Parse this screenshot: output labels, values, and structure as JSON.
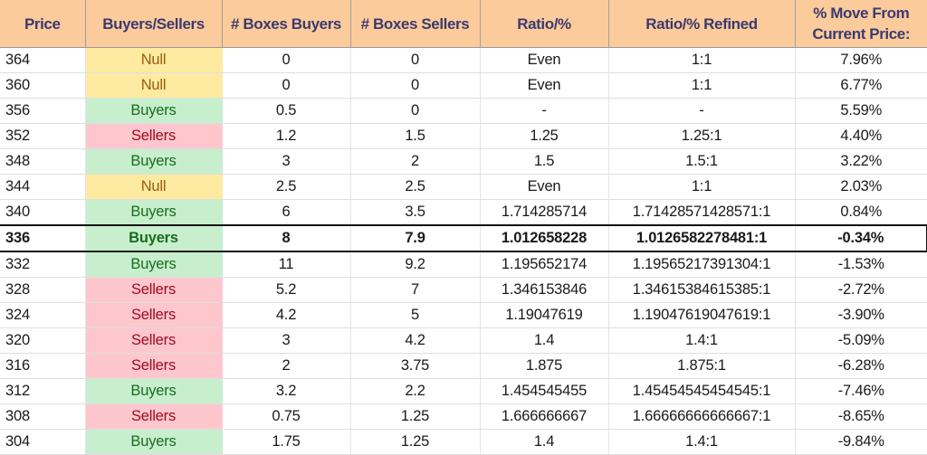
{
  "table": {
    "headers": [
      "Price",
      "Buyers/Sellers",
      "# Boxes Buyers",
      "# Boxes Sellers",
      "Ratio/%",
      "Ratio/% Refined",
      "% Move From Current Price:"
    ],
    "header_line2": "Current Price:",
    "header_line1": "% Move From",
    "current_price_row": "336",
    "colors": {
      "header_bg": "#fccb9c",
      "null_bg": "#feeaa0",
      "null_text": "#9c5b0f",
      "buyers_bg": "#c7efcd",
      "buyers_text": "#1b6b1f",
      "sellers_bg": "#fec7ce",
      "sellers_text": "#9c0a1e"
    },
    "rows": [
      {
        "price": "364",
        "side": "Null",
        "boxes_buyers": "0",
        "boxes_sellers": "0",
        "ratio": "Even",
        "ratio_refined": "1:1",
        "move": "7.96%"
      },
      {
        "price": "360",
        "side": "Null",
        "boxes_buyers": "0",
        "boxes_sellers": "0",
        "ratio": "Even",
        "ratio_refined": "1:1",
        "move": "6.77%"
      },
      {
        "price": "356",
        "side": "Buyers",
        "boxes_buyers": "0.5",
        "boxes_sellers": "0",
        "ratio": "-",
        "ratio_refined": "-",
        "move": "5.59%"
      },
      {
        "price": "352",
        "side": "Sellers",
        "boxes_buyers": "1.2",
        "boxes_sellers": "1.5",
        "ratio": "1.25",
        "ratio_refined": "1.25:1",
        "move": "4.40%"
      },
      {
        "price": "348",
        "side": "Buyers",
        "boxes_buyers": "3",
        "boxes_sellers": "2",
        "ratio": "1.5",
        "ratio_refined": "1.5:1",
        "move": "3.22%"
      },
      {
        "price": "344",
        "side": "Null",
        "boxes_buyers": "2.5",
        "boxes_sellers": "2.5",
        "ratio": "Even",
        "ratio_refined": "1:1",
        "move": "2.03%"
      },
      {
        "price": "340",
        "side": "Buyers",
        "boxes_buyers": "6",
        "boxes_sellers": "3.5",
        "ratio": "1.714285714",
        "ratio_refined": "1.71428571428571:1",
        "move": "0.84%"
      },
      {
        "price": "336",
        "side": "Buyers",
        "boxes_buyers": "8",
        "boxes_sellers": "7.9",
        "ratio": "1.012658228",
        "ratio_refined": "1.0126582278481:1",
        "move": "-0.34%"
      },
      {
        "price": "332",
        "side": "Buyers",
        "boxes_buyers": "11",
        "boxes_sellers": "9.2",
        "ratio": "1.195652174",
        "ratio_refined": "1.19565217391304:1",
        "move": "-1.53%"
      },
      {
        "price": "328",
        "side": "Sellers",
        "boxes_buyers": "5.2",
        "boxes_sellers": "7",
        "ratio": "1.346153846",
        "ratio_refined": "1.34615384615385:1",
        "move": "-2.72%"
      },
      {
        "price": "324",
        "side": "Sellers",
        "boxes_buyers": "4.2",
        "boxes_sellers": "5",
        "ratio": "1.19047619",
        "ratio_refined": "1.19047619047619:1",
        "move": "-3.90%"
      },
      {
        "price": "320",
        "side": "Sellers",
        "boxes_buyers": "3",
        "boxes_sellers": "4.2",
        "ratio": "1.4",
        "ratio_refined": "1.4:1",
        "move": "-5.09%"
      },
      {
        "price": "316",
        "side": "Sellers",
        "boxes_buyers": "2",
        "boxes_sellers": "3.75",
        "ratio": "1.875",
        "ratio_refined": "1.875:1",
        "move": "-6.28%"
      },
      {
        "price": "312",
        "side": "Buyers",
        "boxes_buyers": "3.2",
        "boxes_sellers": "2.2",
        "ratio": "1.454545455",
        "ratio_refined": "1.45454545454545:1",
        "move": "-7.46%"
      },
      {
        "price": "308",
        "side": "Sellers",
        "boxes_buyers": "0.75",
        "boxes_sellers": "1.25",
        "ratio": "1.666666667",
        "ratio_refined": "1.66666666666667:1",
        "move": "-8.65%"
      },
      {
        "price": "304",
        "side": "Buyers",
        "boxes_buyers": "1.75",
        "boxes_sellers": "1.25",
        "ratio": "1.4",
        "ratio_refined": "1.4:1",
        "move": "-9.84%"
      }
    ]
  }
}
